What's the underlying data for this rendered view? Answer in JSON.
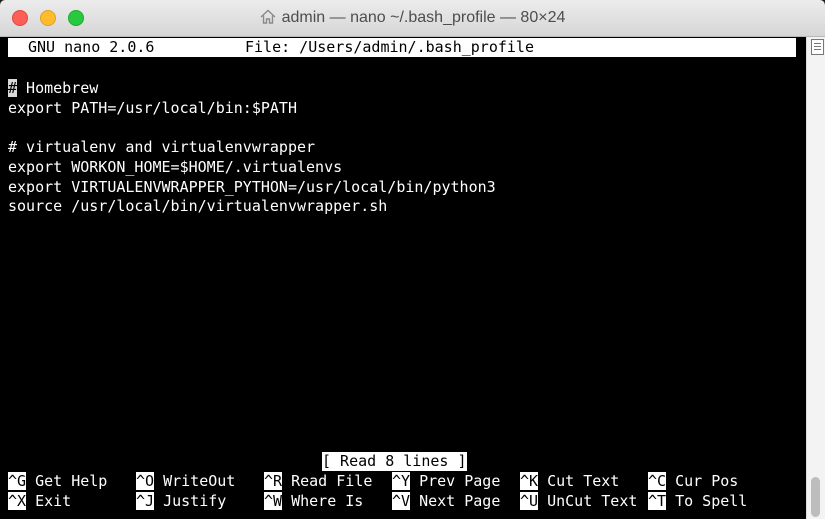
{
  "window": {
    "title": "admin — nano ~/.bash_profile — 80×24"
  },
  "nano": {
    "header_version": "GNU nano 2.0.6",
    "header_file": "File: /Users/admin/.bash_profile",
    "lines": [
      "",
      "# Homebrew",
      "export PATH=/usr/local/bin:$PATH",
      "",
      "# virtualenv and virtualenvwrapper",
      "export WORKON_HOME=$HOME/.virtualenvs",
      "export VIRTUALENVWRAPPER_PYTHON=/usr/local/bin/python3",
      "source /usr/local/bin/virtualenvwrapper.sh"
    ],
    "line1_cursor_char": "#",
    "line1_rest": " Homebrew",
    "status": "[ Read 8 lines ]",
    "shortcuts_row1": [
      {
        "key": "^G",
        "label": "Get Help"
      },
      {
        "key": "^O",
        "label": "WriteOut"
      },
      {
        "key": "^R",
        "label": "Read File"
      },
      {
        "key": "^Y",
        "label": "Prev Page"
      },
      {
        "key": "^K",
        "label": "Cut Text"
      },
      {
        "key": "^C",
        "label": "Cur Pos"
      }
    ],
    "shortcuts_row2": [
      {
        "key": "^X",
        "label": "Exit"
      },
      {
        "key": "^J",
        "label": "Justify"
      },
      {
        "key": "^W",
        "label": "Where Is"
      },
      {
        "key": "^V",
        "label": "Next Page"
      },
      {
        "key": "^U",
        "label": "UnCut Text"
      },
      {
        "key": "^T",
        "label": "To Spell"
      }
    ]
  },
  "icons": {
    "title_icon": "home-icon"
  }
}
